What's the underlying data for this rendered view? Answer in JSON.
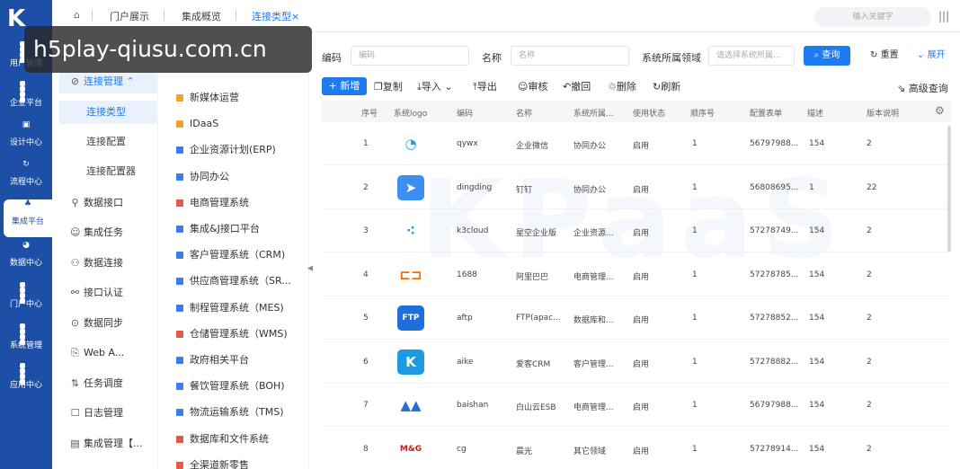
{
  "rail": {
    "logo": "K",
    "items": [
      {
        "label": "用户管理",
        "icon": "user-icon"
      },
      {
        "label": "企业平台",
        "icon": "grid-icon"
      },
      {
        "label": "设计中心",
        "icon": "design-icon"
      },
      {
        "label": "流程中心",
        "icon": "flow-icon"
      },
      {
        "label": "集成平台",
        "icon": "integration-icon"
      },
      {
        "label": "数据中心",
        "icon": "pie-icon"
      },
      {
        "label": "门户中心",
        "icon": "grid-icon"
      },
      {
        "label": "系统管理",
        "icon": "grid-icon"
      },
      {
        "label": "应用中心",
        "icon": "grid-icon"
      }
    ]
  },
  "watermark": "h5play-qiusu.com.cn",
  "background_watermark": "KPaaS",
  "tabs": [
    "门户展示",
    "集成概览",
    "连接类型×"
  ],
  "top_search_placeholder": "输入关键字",
  "subnav": [
    {
      "label": "连接管理",
      "type": "open"
    },
    {
      "label": "连接类型",
      "type": "child-active"
    },
    {
      "label": "连接配置",
      "type": "child"
    },
    {
      "label": "连接配置器",
      "type": "child"
    },
    {
      "label": "数据接口",
      "type": "item"
    },
    {
      "label": "集成任务",
      "type": "item"
    },
    {
      "label": "数据连接",
      "type": "item"
    },
    {
      "label": "接口认证",
      "type": "item"
    },
    {
      "label": "数据同步",
      "type": "item"
    },
    {
      "label": "Web A...",
      "type": "item"
    },
    {
      "label": "任务调度",
      "type": "item"
    },
    {
      "label": "日志管理",
      "type": "item"
    },
    {
      "label": "集成管理【...",
      "type": "item"
    }
  ],
  "categories": [
    {
      "label": "新媒体运营",
      "color": "#f0a030"
    },
    {
      "label": "IDaaS",
      "color": "#f0a030"
    },
    {
      "label": "企业资源计划(ERP)",
      "color": "#3b7ee8"
    },
    {
      "label": "协同办公",
      "color": "#3b7ee8"
    },
    {
      "label": "电商管理系统",
      "color": "#e05b4b"
    },
    {
      "label": "集成&J接口平台",
      "color": "#3b7ee8"
    },
    {
      "label": "客户管理系统（CRM)",
      "color": "#3b7ee8"
    },
    {
      "label": "供应商管理系统（SR...",
      "color": "#3b7ee8"
    },
    {
      "label": "制程管理系统（MES)",
      "color": "#3b7ee8"
    },
    {
      "label": "仓储管理系统（WMS)",
      "color": "#e05b4b"
    },
    {
      "label": "政府相关平台",
      "color": "#3b7ee8"
    },
    {
      "label": "餐饮管理系统（BOH)",
      "color": "#3b7ee8"
    },
    {
      "label": "物流运输系统（TMS)",
      "color": "#3b7ee8"
    },
    {
      "label": "数据库和文件系统",
      "color": "#e05b4b"
    },
    {
      "label": "全渠道新零售",
      "color": "#e05b4b"
    }
  ],
  "filters": {
    "code_label": "编码",
    "code_placeholder": "编码",
    "name_label": "名称",
    "name_placeholder": "名称",
    "domain_label": "系统所属领域",
    "domain_placeholder": "请选择系统所属...",
    "query": "查询",
    "reset": "重置",
    "expand": "展开"
  },
  "toolbar": {
    "new": "+ 新增",
    "buttons": [
      "复制",
      "导入",
      "导出",
      "审核",
      "撤回",
      "删除",
      "刷新"
    ],
    "advanced": "高级查询"
  },
  "table": {
    "headers": [
      "序号",
      "系统logo",
      "编码",
      "名称",
      "系统所属...",
      "使用状态",
      "顺序号",
      "配置表单",
      "描述",
      "版本说明"
    ],
    "rows": [
      {
        "no": "1",
        "logo": "wecom",
        "code": "qywx",
        "name": "企业微信",
        "domain": "协同办公",
        "status": "启用",
        "order": "1",
        "form": "56797988...",
        "desc": "154",
        "ver": "2"
      },
      {
        "no": "2",
        "logo": "dingtalk",
        "code": "dingding",
        "name": "钉钉",
        "domain": "协同办公",
        "status": "启用",
        "order": "1",
        "form": "56808695...",
        "desc": "1",
        "ver": "22"
      },
      {
        "no": "3",
        "logo": "k3cloud",
        "code": "k3cloud",
        "name": "星空企业版",
        "domain": "企业资源...",
        "status": "启用",
        "order": "1",
        "form": "57278749...",
        "desc": "154",
        "ver": "2"
      },
      {
        "no": "4",
        "logo": "alibaba",
        "code": "1688",
        "name": "阿里巴巴",
        "domain": "电商管理...",
        "status": "启用",
        "order": "1",
        "form": "57278785...",
        "desc": "154",
        "ver": "2"
      },
      {
        "no": "5",
        "logo": "ftp",
        "code": "aftp",
        "name": "FTP(apac...",
        "domain": "数据库和...",
        "status": "启用",
        "order": "1",
        "form": "57278852...",
        "desc": "154",
        "ver": "2"
      },
      {
        "no": "6",
        "logo": "aike",
        "code": "aike",
        "name": "爱客CRM",
        "domain": "客户管理...",
        "status": "启用",
        "order": "1",
        "form": "57278882...",
        "desc": "154",
        "ver": "2"
      },
      {
        "no": "7",
        "logo": "baishan",
        "code": "baishan",
        "name": "白山云ESB",
        "domain": "电商管理...",
        "status": "启用",
        "order": "1",
        "form": "56797988...",
        "desc": "154",
        "ver": "2"
      },
      {
        "no": "8",
        "logo": "mg",
        "code": "cg",
        "name": "晨光",
        "domain": "其它领域",
        "status": "启用",
        "order": "1",
        "form": "57278914...",
        "desc": "154",
        "ver": "2"
      }
    ]
  }
}
